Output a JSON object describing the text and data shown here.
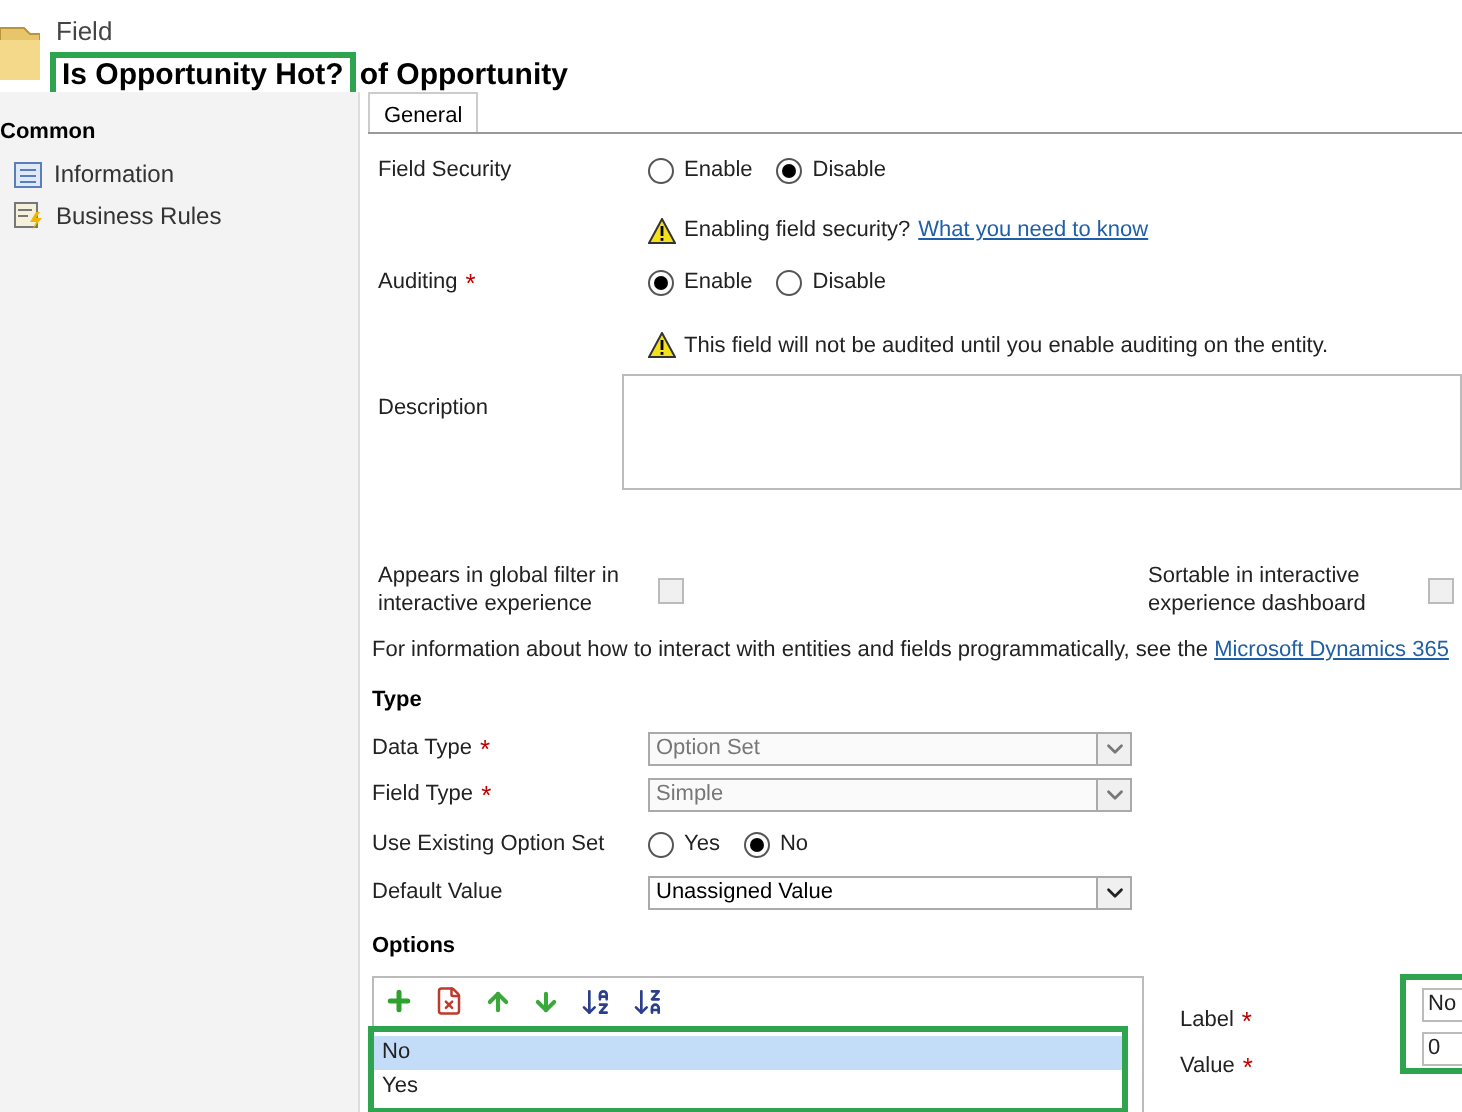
{
  "header": {
    "breadcrumb": "Field",
    "title_highlighted": "Is Opportunity Hot?",
    "title_rest": "of Opportunity"
  },
  "sidebar": {
    "heading": "Common",
    "items": [
      {
        "label": "Information",
        "kind": "info"
      },
      {
        "label": "Business Rules",
        "kind": "rules"
      }
    ]
  },
  "tabs": [
    {
      "label": "General",
      "selected": true
    }
  ],
  "field_security": {
    "label": "Field Security",
    "options": [
      {
        "label": "Enable",
        "selected": false
      },
      {
        "label": "Disable",
        "selected": true
      }
    ],
    "warning": "Enabling field security?",
    "warning_link": "What you need to know"
  },
  "auditing": {
    "label": "Auditing",
    "required_mark": "*",
    "options": [
      {
        "label": "Enable",
        "selected": true
      },
      {
        "label": "Disable",
        "selected": false
      }
    ],
    "warning": "This field will not be audited until you enable auditing on the entity."
  },
  "description": {
    "label": "Description"
  },
  "interactive": [
    {
      "label": "Appears in global filter in interactive experience",
      "checked": false
    },
    {
      "label": "Sortable in interactive experience dashboard",
      "checked": false
    }
  ],
  "info": {
    "text": "For information about how to interact with entities and fields programmatically, see the",
    "link": "Microsoft Dynamics 365"
  },
  "type_section": {
    "heading": "Type",
    "rows": [
      {
        "kind": "select",
        "label": "Data Type",
        "required_mark": "*",
        "value": "Option Set",
        "disabled": true
      },
      {
        "kind": "select",
        "label": "Field Type",
        "required_mark": "*",
        "value": "Simple",
        "disabled": true
      },
      {
        "kind": "radio",
        "label": "Use Existing Option Set",
        "options": [
          {
            "label": "Yes",
            "selected": false
          },
          {
            "label": "No",
            "selected": true
          }
        ]
      },
      {
        "kind": "select",
        "label": "Default Value",
        "value": "Unassigned Value",
        "disabled": false
      }
    ]
  },
  "options": {
    "heading": "Options",
    "items": [
      {
        "label": "No",
        "selected": true
      },
      {
        "label": "Yes",
        "selected": false
      }
    ],
    "fields": [
      {
        "label": "Label",
        "required_mark": "*",
        "value": "No"
      },
      {
        "label": "Value",
        "required_mark": "*",
        "value": "0"
      }
    ]
  }
}
